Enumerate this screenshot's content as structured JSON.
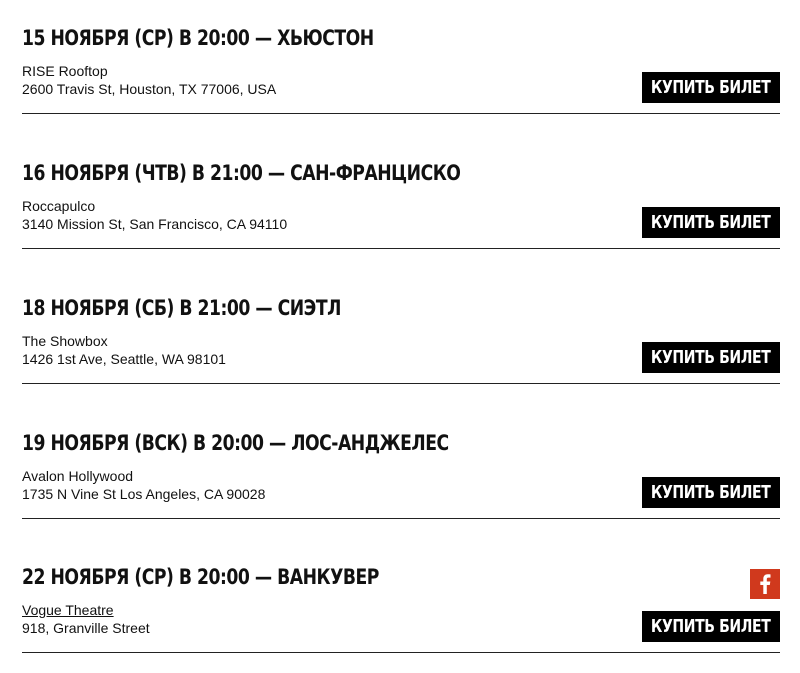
{
  "buy_label": "КУПИТЬ БИЛЕТ",
  "accent_colors": {
    "button_bg": "#000000",
    "button_text": "#ffffff",
    "facebook_bg": "#d0391d"
  },
  "events": [
    {
      "title": "15 НОЯБРЯ (СР) В 20:00 — ХЬЮСТОН",
      "venue": "RISE Rooftop",
      "address": "2600 Travis St, Houston, TX 77006, USA"
    },
    {
      "title": "16 НОЯБРЯ (ЧТВ) В 21:00 — САН-ФРАНЦИСКО",
      "venue": "Roccapulco",
      "address": "3140 Mission St, San Francisco, CA 94110"
    },
    {
      "title": "18 НОЯБРЯ (СБ) В 21:00 — СИЭТЛ",
      "venue": "The Showbox",
      "address": "1426 1st Ave, Seattle, WA 98101"
    },
    {
      "title": "19 НОЯБРЯ (ВСК) В 20:00 — ЛОС-АНДЖЕЛЕС",
      "venue": "Avalon Hollywood",
      "address": "1735 N Vine St Los Angeles, CA 90028"
    },
    {
      "title": "22 НОЯБРЯ (СР) В 20:00 — ВАНКУВЕР",
      "venue": "Vogue Theatre",
      "address": "918, Granville Street",
      "social_icon": "facebook-icon"
    }
  ]
}
